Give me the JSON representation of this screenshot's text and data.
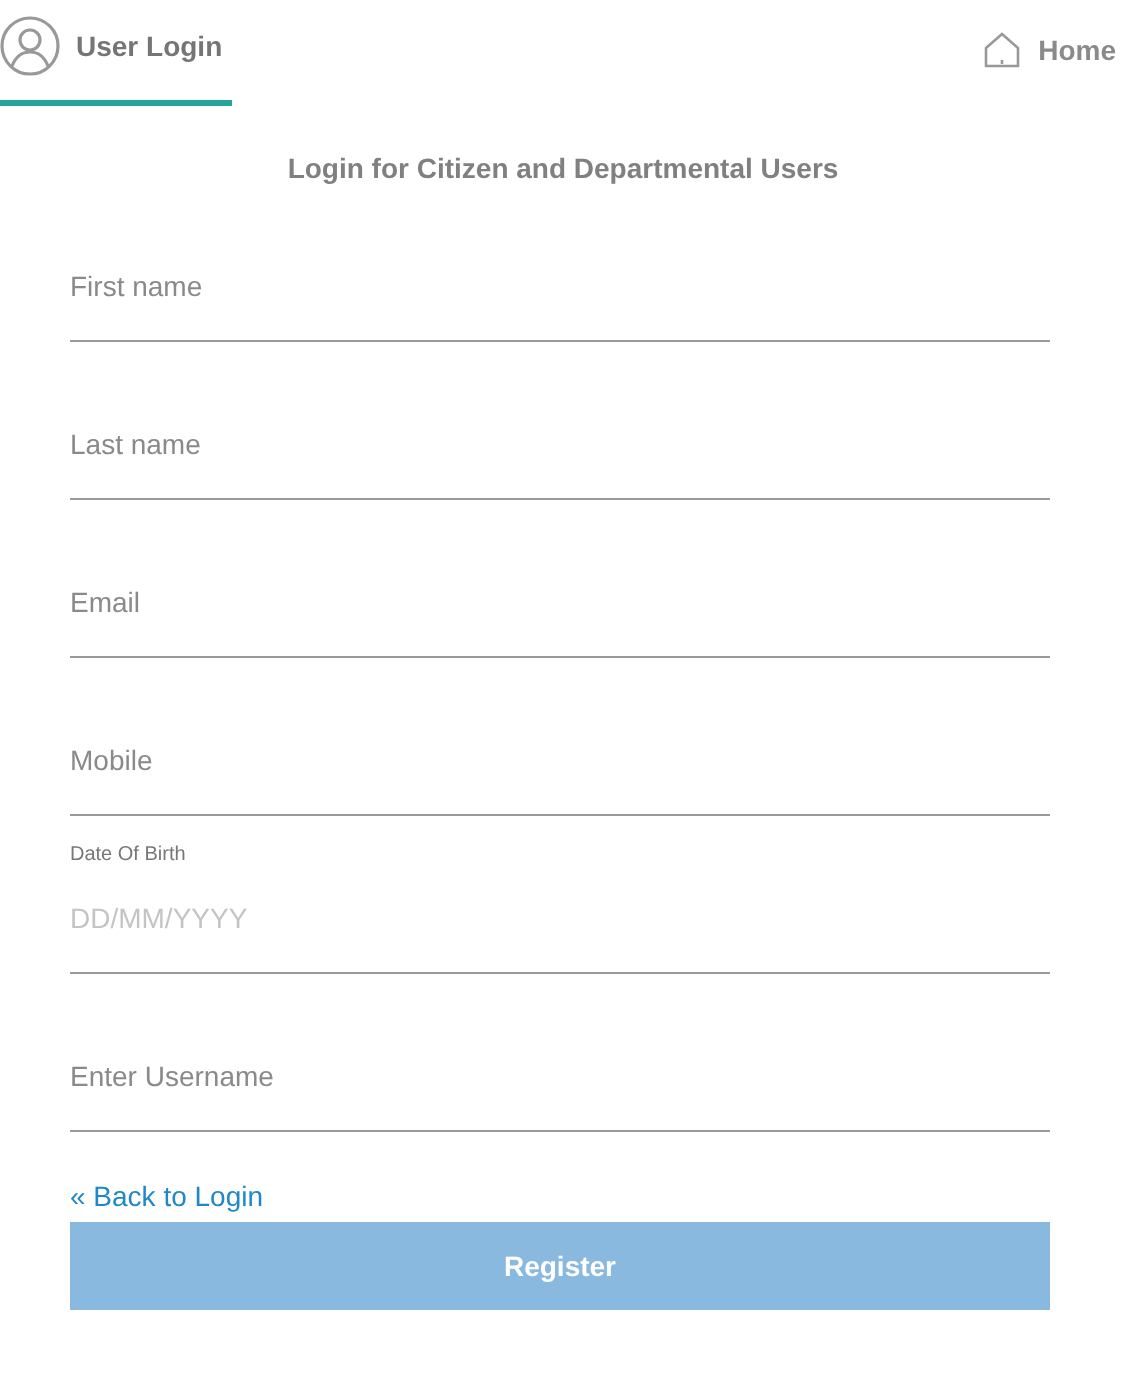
{
  "tabs": [
    {
      "label": "User Login",
      "selected": true
    }
  ],
  "home_link": {
    "label": "Home"
  },
  "subtitle": "Login for Citizen and Departmental Users",
  "fields": [
    {
      "kind": "text",
      "placeholder": "First name"
    },
    {
      "kind": "text",
      "placeholder": "Last name"
    },
    {
      "kind": "text",
      "placeholder": "Email"
    },
    {
      "kind": "text",
      "placeholder": "Mobile"
    },
    {
      "kind": "date",
      "label": "Date Of Birth",
      "placeholder": "DD/MM/YYYY"
    },
    {
      "kind": "text",
      "placeholder": "Enter Username"
    }
  ],
  "back_link": "« Back to Login",
  "register_button": {
    "label": "Register",
    "disabled": true
  }
}
